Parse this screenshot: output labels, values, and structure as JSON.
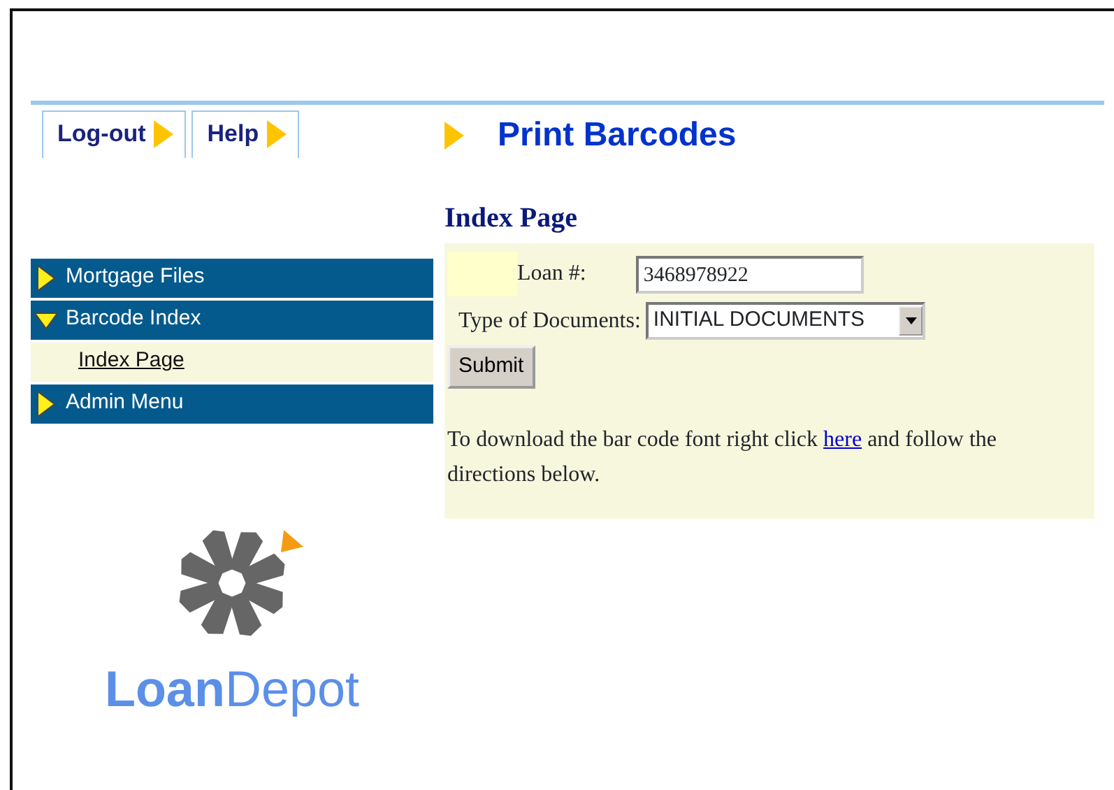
{
  "top_tabs": [
    {
      "label": "Log-out"
    },
    {
      "label": "Help"
    }
  ],
  "page_title": "Print Barcodes",
  "sidebar": {
    "items": [
      {
        "label": "Mortgage Files",
        "expanded": false
      },
      {
        "label": "Barcode Index",
        "expanded": true,
        "children": [
          {
            "label": "Index Page"
          }
        ]
      },
      {
        "label": "Admin Menu",
        "expanded": false
      }
    ]
  },
  "logo": {
    "text": "**Loan**Depot"
  },
  "form": {
    "heading": "Index Page",
    "loan_label": "Loan #:",
    "loan_value": "3468978922",
    "type_label": "Type of Documents:",
    "type_value": "INITIAL DOCUMENTS",
    "submit": "Submit",
    "note_before": "To download the bar code font right click",
    "note_link": "here",
    "note_after": "and follow the directions below."
  }
}
